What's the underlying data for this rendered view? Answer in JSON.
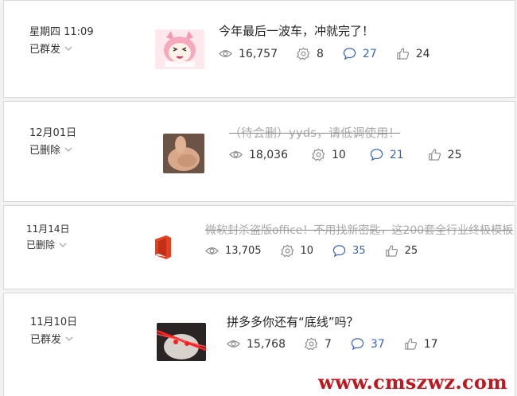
{
  "posts": [
    {
      "date": "星期四 11:09",
      "status": "已群发",
      "title": "今年最后一波车，冲就完了！",
      "deleted": false,
      "thumb": "anime-girl",
      "views": "16,757",
      "shares": "8",
      "comments": "27",
      "likes": "24"
    },
    {
      "date": "12月01日",
      "status": "已删除",
      "title": "（待会删）yyds，请低调使用！",
      "deleted": true,
      "thumb": "thumbs-up-hand",
      "views": "18,036",
      "shares": "10",
      "comments": "21",
      "likes": "25"
    },
    {
      "date": "11月14日",
      "status": "已删除",
      "title": "微软封杀盗版office！不用找新密匙，这200套全行业终极模板",
      "deleted": true,
      "thumb": "office-logo",
      "views": "13,705",
      "shares": "10",
      "comments": "35",
      "likes": "25"
    },
    {
      "date": "11月10日",
      "status": "已群发",
      "title": "拼多多你还有“底线”吗？",
      "deleted": false,
      "thumb": "laser-eyes",
      "views": "15,768",
      "shares": "7",
      "comments": "37",
      "likes": "17"
    }
  ],
  "watermark": "www.cmszwz.com",
  "colors": {
    "link": "#3a64b8",
    "watermark": "#c0161d"
  },
  "icons": [
    "eye-icon",
    "gear-icon",
    "comment-icon",
    "thumbs-up-icon",
    "chevron-down-icon"
  ]
}
